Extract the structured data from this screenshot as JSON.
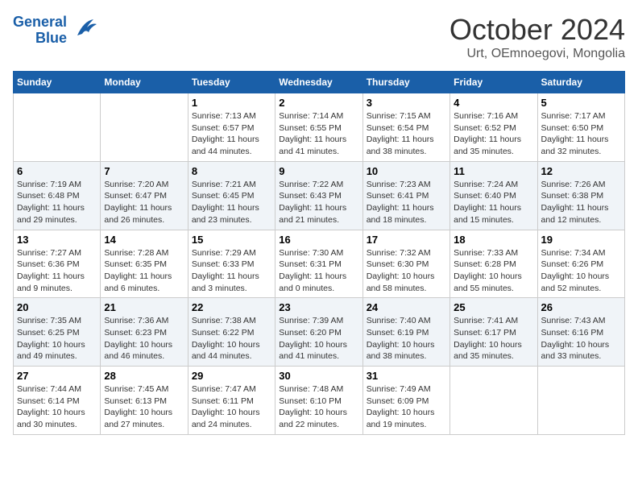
{
  "logo": {
    "line1": "General",
    "line2": "Blue"
  },
  "title": "October 2024",
  "location": "Urt, OEmnoegovi, Mongolia",
  "days_of_week": [
    "Sunday",
    "Monday",
    "Tuesday",
    "Wednesday",
    "Thursday",
    "Friday",
    "Saturday"
  ],
  "weeks": [
    [
      {
        "day": "",
        "info": ""
      },
      {
        "day": "",
        "info": ""
      },
      {
        "day": "1",
        "info": "Sunrise: 7:13 AM\nSunset: 6:57 PM\nDaylight: 11 hours and 44 minutes."
      },
      {
        "day": "2",
        "info": "Sunrise: 7:14 AM\nSunset: 6:55 PM\nDaylight: 11 hours and 41 minutes."
      },
      {
        "day": "3",
        "info": "Sunrise: 7:15 AM\nSunset: 6:54 PM\nDaylight: 11 hours and 38 minutes."
      },
      {
        "day": "4",
        "info": "Sunrise: 7:16 AM\nSunset: 6:52 PM\nDaylight: 11 hours and 35 minutes."
      },
      {
        "day": "5",
        "info": "Sunrise: 7:17 AM\nSunset: 6:50 PM\nDaylight: 11 hours and 32 minutes."
      }
    ],
    [
      {
        "day": "6",
        "info": "Sunrise: 7:19 AM\nSunset: 6:48 PM\nDaylight: 11 hours and 29 minutes."
      },
      {
        "day": "7",
        "info": "Sunrise: 7:20 AM\nSunset: 6:47 PM\nDaylight: 11 hours and 26 minutes."
      },
      {
        "day": "8",
        "info": "Sunrise: 7:21 AM\nSunset: 6:45 PM\nDaylight: 11 hours and 23 minutes."
      },
      {
        "day": "9",
        "info": "Sunrise: 7:22 AM\nSunset: 6:43 PM\nDaylight: 11 hours and 21 minutes."
      },
      {
        "day": "10",
        "info": "Sunrise: 7:23 AM\nSunset: 6:41 PM\nDaylight: 11 hours and 18 minutes."
      },
      {
        "day": "11",
        "info": "Sunrise: 7:24 AM\nSunset: 6:40 PM\nDaylight: 11 hours and 15 minutes."
      },
      {
        "day": "12",
        "info": "Sunrise: 7:26 AM\nSunset: 6:38 PM\nDaylight: 11 hours and 12 minutes."
      }
    ],
    [
      {
        "day": "13",
        "info": "Sunrise: 7:27 AM\nSunset: 6:36 PM\nDaylight: 11 hours and 9 minutes."
      },
      {
        "day": "14",
        "info": "Sunrise: 7:28 AM\nSunset: 6:35 PM\nDaylight: 11 hours and 6 minutes."
      },
      {
        "day": "15",
        "info": "Sunrise: 7:29 AM\nSunset: 6:33 PM\nDaylight: 11 hours and 3 minutes."
      },
      {
        "day": "16",
        "info": "Sunrise: 7:30 AM\nSunset: 6:31 PM\nDaylight: 11 hours and 0 minutes."
      },
      {
        "day": "17",
        "info": "Sunrise: 7:32 AM\nSunset: 6:30 PM\nDaylight: 10 hours and 58 minutes."
      },
      {
        "day": "18",
        "info": "Sunrise: 7:33 AM\nSunset: 6:28 PM\nDaylight: 10 hours and 55 minutes."
      },
      {
        "day": "19",
        "info": "Sunrise: 7:34 AM\nSunset: 6:26 PM\nDaylight: 10 hours and 52 minutes."
      }
    ],
    [
      {
        "day": "20",
        "info": "Sunrise: 7:35 AM\nSunset: 6:25 PM\nDaylight: 10 hours and 49 minutes."
      },
      {
        "day": "21",
        "info": "Sunrise: 7:36 AM\nSunset: 6:23 PM\nDaylight: 10 hours and 46 minutes."
      },
      {
        "day": "22",
        "info": "Sunrise: 7:38 AM\nSunset: 6:22 PM\nDaylight: 10 hours and 44 minutes."
      },
      {
        "day": "23",
        "info": "Sunrise: 7:39 AM\nSunset: 6:20 PM\nDaylight: 10 hours and 41 minutes."
      },
      {
        "day": "24",
        "info": "Sunrise: 7:40 AM\nSunset: 6:19 PM\nDaylight: 10 hours and 38 minutes."
      },
      {
        "day": "25",
        "info": "Sunrise: 7:41 AM\nSunset: 6:17 PM\nDaylight: 10 hours and 35 minutes."
      },
      {
        "day": "26",
        "info": "Sunrise: 7:43 AM\nSunset: 6:16 PM\nDaylight: 10 hours and 33 minutes."
      }
    ],
    [
      {
        "day": "27",
        "info": "Sunrise: 7:44 AM\nSunset: 6:14 PM\nDaylight: 10 hours and 30 minutes."
      },
      {
        "day": "28",
        "info": "Sunrise: 7:45 AM\nSunset: 6:13 PM\nDaylight: 10 hours and 27 minutes."
      },
      {
        "day": "29",
        "info": "Sunrise: 7:47 AM\nSunset: 6:11 PM\nDaylight: 10 hours and 24 minutes."
      },
      {
        "day": "30",
        "info": "Sunrise: 7:48 AM\nSunset: 6:10 PM\nDaylight: 10 hours and 22 minutes."
      },
      {
        "day": "31",
        "info": "Sunrise: 7:49 AM\nSunset: 6:09 PM\nDaylight: 10 hours and 19 minutes."
      },
      {
        "day": "",
        "info": ""
      },
      {
        "day": "",
        "info": ""
      }
    ]
  ]
}
